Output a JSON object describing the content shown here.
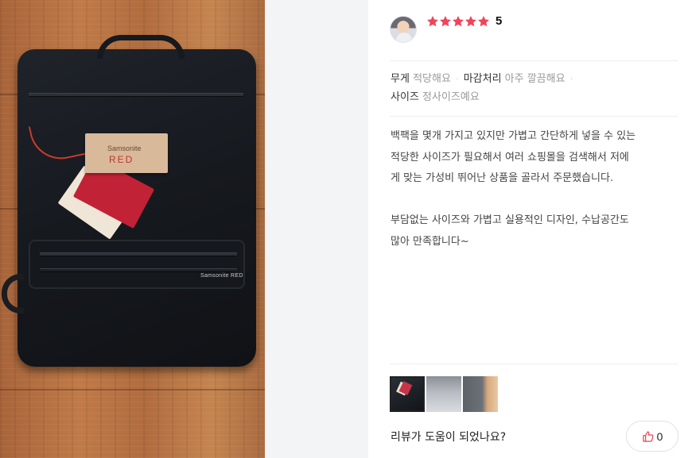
{
  "review": {
    "rating": {
      "stars_filled": 5,
      "stars_total": 5,
      "score_text": "5",
      "star_color": "#f0445a"
    },
    "attributes": [
      {
        "key": "무게",
        "value": "적당해요"
      },
      {
        "key": "마감처리",
        "value": "아주 깔끔해요"
      },
      {
        "key": "사이즈",
        "value": "정사이즈예요"
      }
    ],
    "attribute_separator": "·",
    "body": "백팩을 몇개 가지고 있지만 가볍고 간단하게 넣을 수 있는\n적당한 사이즈가 필요해서 여러 쇼핑몰을 검색해서 저에\n게 맞는 가성비 뛰어난 상품을 골라서 주문했습니다.\n\n부담없는 사이즈와 가볍고 실용적인 디자인, 수납공간도\n많아 만족합니다~",
    "photos": [
      {
        "icon": "backpack-photo",
        "selected": true
      },
      {
        "icon": "backpack-photo",
        "selected": false
      },
      {
        "icon": "backpack-photo",
        "selected": false
      }
    ],
    "helpful": {
      "question": "리뷰가 도움이 되었나요?",
      "like_count": "0",
      "like_icon": "thumbs-up-icon"
    }
  },
  "product_photo": {
    "tag_brand": "Samsonite",
    "tag_line": "RED",
    "bag_logo": "Samsonite RED"
  }
}
